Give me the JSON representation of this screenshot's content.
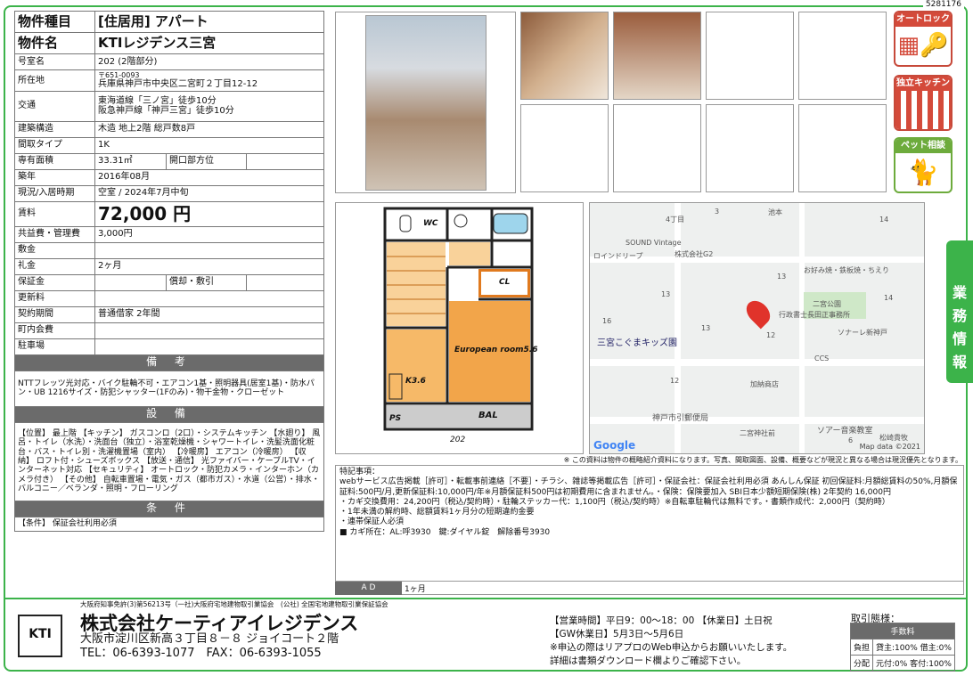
{
  "doc_id": "5281176",
  "spec": {
    "type_label": "物件種目",
    "type_value": "[住居用] アパート",
    "name_label": "物件名",
    "name_value": "KTIレジデンス三宮",
    "room_label": "号室名",
    "room_value": "202 (2階部分)",
    "addr_label": "所在地",
    "zip": "〒651-0093",
    "addr_value": "兵庫県神戸市中央区二宮町２丁目12-12",
    "traffic_label": "交通",
    "traffic1": "東海道線「三ノ宮」徒歩10分",
    "traffic2": "阪急神戸線「神戸三宮」徒歩10分",
    "struct_label": "建築構造",
    "struct_value": "木造 地上2階 総戸数8戸",
    "layout_label": "間取タイプ",
    "layout_value": "1K",
    "area_label": "専有面積",
    "area_value": "33.31㎡",
    "opening_label": "開口部方位",
    "opening_value": "",
    "built_label": "築年",
    "built_value": "2016年08月",
    "status_label": "現況/入居時期",
    "status_value": "空室 / 2024年7月中旬",
    "rent_label": "賃料",
    "rent_value": "72,000 円",
    "fee_label": "共益費・管理費",
    "fee_value": "3,000円",
    "deposit_label": "敷金",
    "deposit_value": "",
    "key_label": "礼金",
    "key_value": "2ヶ月",
    "guarantee_label": "保証金",
    "guarantee_value": "",
    "repay_label": "償却・敷引",
    "repay_value": "",
    "renew_label": "更新料",
    "renew_value": "",
    "contract_label": "契約期間",
    "contract_value": "普通借家 2年間",
    "town_label": "町内会費",
    "town_value": "",
    "parking_label": "駐車場",
    "parking_value": ""
  },
  "remarks": {
    "head": "備 考",
    "text": "NTTフレッツ光対応・バイク駐輪不可・エアコン1基・照明器具(居室1基)・防水パン・UB 1216サイズ・防犯シャッター(1Fのみ)・物干金物・クローゼット"
  },
  "equipment": {
    "head": "設 備",
    "text": "【位置】 最上階 【キッチン】 ガスコンロ（2口）・システムキッチン 【水廻り】 風呂・トイレ（水洗）・洗面台（独立）・浴室乾燥機・シャワートイレ・洗髪洗面化粧台・バス・トイレ別・洗濯機置場（室内） 【冷暖房】 エアコン（冷暖房） 【収納】 ロフト付・シューズボックス 【放送・通信】 光ファイバー・ケーブルTV・インターネット対応 【セキュリティ】 オートロック・防犯カメラ・インターホン（カメラ付き） 【その他】 自転車置場・電気・ガス（都市ガス）・水道（公営）・排水・バルコニー／ベランダ・照明・フローリング"
  },
  "conditions": {
    "head": "条 件",
    "text": "【条件】 保証会社利用必須"
  },
  "badges": [
    "オートロック",
    "独立キッチン",
    "ペット相談"
  ],
  "floorplan": {
    "wc": "WC",
    "cl": "CL",
    "room": "European room5.6",
    "k": "K3.6",
    "ps": "PS",
    "bal": "BAL",
    "room_no": "202"
  },
  "map": {
    "labels": [
      "4丁目",
      "3",
      "池本",
      "14",
      "SOUND Vintage",
      "株式会社G2",
      "ロインドリープ",
      "13",
      "13",
      "お好み焼・鉄板焼・ちえり",
      "二宮公園",
      "行政書士長田正事務所",
      "16",
      "14",
      "三宮こぐまキッズ園",
      "13",
      "12",
      "ソナーレ新神戸",
      "CCS",
      "12",
      "加納商店",
      "神戸市引郵便局",
      "二宮神社前",
      "ソアー音楽教室",
      "6",
      "松崎貴牧"
    ],
    "google": "Google",
    "credit": "Map data ©2021"
  },
  "side_tab": [
    "業",
    "務",
    "情",
    "報"
  ],
  "disclaimer": "※ この資料は物件の概略紹介資料になります。写真、間取図面、設備、概要などが現況と異なる場合は現況優先となります。",
  "notes": {
    "head": "特記事項：",
    "lines": [
      "webサービス広告掲載［許可］・転載事前連絡［不要］・チラシ、雑誌等掲載広告［許可］・保証会社：保証会社利用必須 あんしん保証 初回保証料:月額総賃料の50%,月額保証料:500円/月,更新保証料:10,000円/年※月額保証料500円は初期費用に含まれません。・保険：保険要加入 SBI日本少額短期保険(株) 2年契約 16,000円",
      "・カギ交換費用：24,200円（税込/契約時）・駐輪ステッカー代：1,100円（税込/契約時）※自転車駐輪代は無料です。・書類作成代：2,000円（契約時）",
      "・1年未満の解約時、総額賃料1ヶ月分の短期違約金要",
      "・連帯保証人必須",
      "■ カギ所在：AL:呼3930　鍵:ダイヤル錠　解除番号3930"
    ]
  },
  "ad": {
    "label": "A D",
    "value": "1ヶ月"
  },
  "footer": {
    "license": "大阪府知事免許(3)第56213号（一社)大阪府宅地建物取引業協会　(公社) 全国宅地建物取引業保証協会",
    "logo": "KTI",
    "company": "株式会社ケーティアイレジデンス",
    "address": "大阪市淀川区新高３丁目８－８ ジョイコート２階",
    "tel": "TEL：06-6393-1077　FAX：06-6393-1055",
    "hours1": "【営業時間】平日9：00～18：00 【休業日】土日祝",
    "hours2": "【GW休業日】5月3日～5月6日",
    "hours3": "※申込の際はリアプロのWeb申込からお願いいたします。",
    "hours4": "詳細は書類ダウンロード欄よりご確認下さい。",
    "deal_title": "取引態様：",
    "fee_head": "手数料",
    "row1_k": "負担",
    "row1_v": "貸主:100% 借主:0%",
    "row2_k": "分配",
    "row2_v": "元付:0% 客付:100%"
  }
}
